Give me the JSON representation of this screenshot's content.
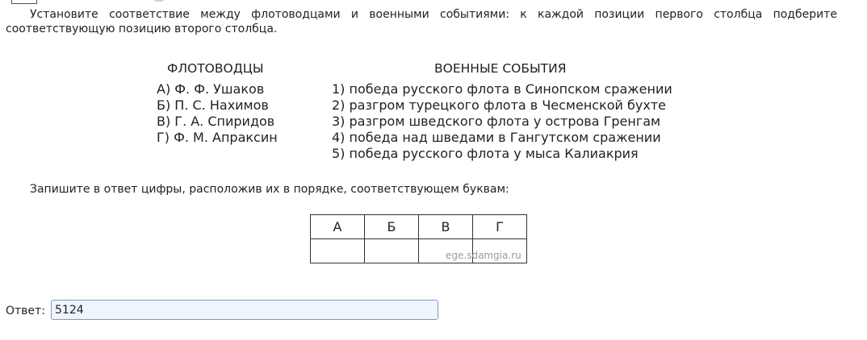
{
  "task": {
    "text": "Установите соответствие между флотоводцами и военными событиями: к каждой позиции первого столбца подберите соответствующую позицию второго столбца."
  },
  "columns": {
    "left_header": "ФЛОТОВОДЦЫ",
    "right_header": "ВОЕННЫЕ СОБЫТИЯ",
    "left_items": [
      "А) Ф. Ф. Ушаков",
      "Б) П. С. Нахимов",
      "В) Г. А. Спиридов",
      "Г) Ф. М. Апраксин"
    ],
    "right_items": [
      "1) победа русского флота в Синопском сражении",
      "2) разгром турецкого флота в Чесменской бухте",
      "3) разгром шведского флота у острова Гренгам",
      "4) победа над шведами в Гангутском сражении",
      "5) победа русского флота у мыса Калиакрия"
    ]
  },
  "instruction": "Запишите в ответ цифры, расположив их в порядке, соответствующем буквам:",
  "answer_table": {
    "headers": [
      "А",
      "Б",
      "В",
      "Г"
    ],
    "cells": [
      "",
      "",
      "",
      ""
    ]
  },
  "watermark": "ege.sdamgia.ru",
  "answer": {
    "label": "Ответ:",
    "value": "5124"
  }
}
